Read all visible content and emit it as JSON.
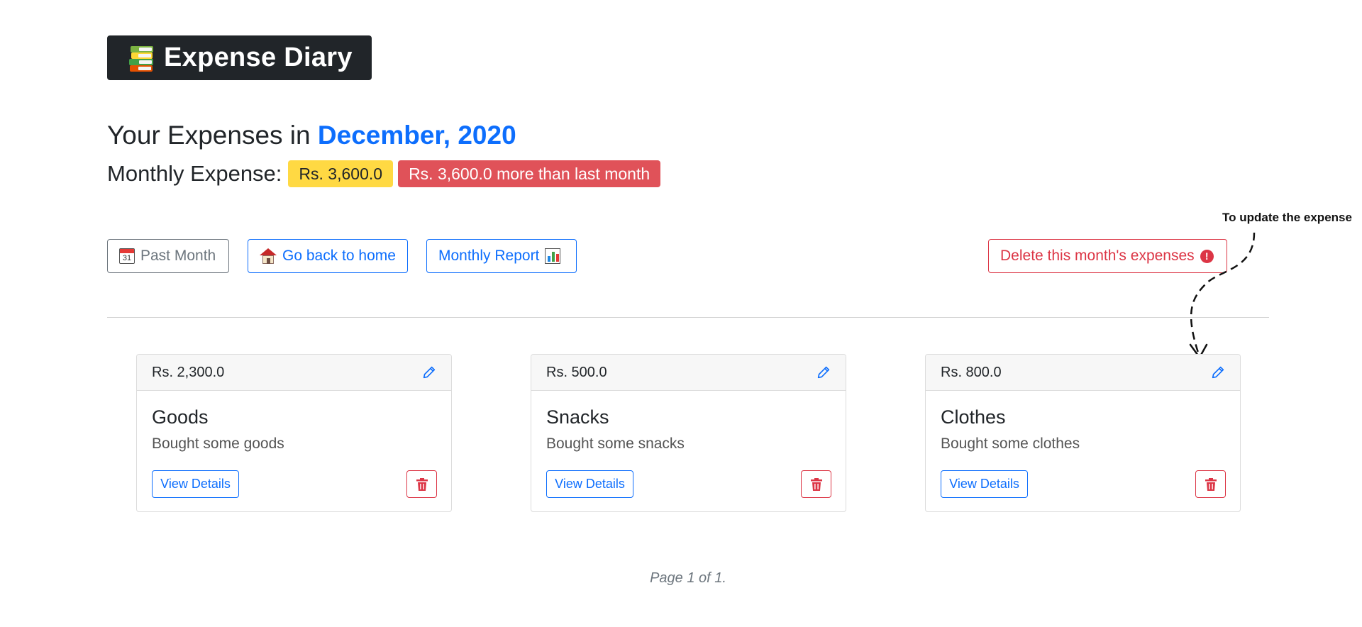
{
  "brand": {
    "title": "Expense Diary",
    "icon": "books-icon"
  },
  "heading": {
    "prefix": "Your Expenses in ",
    "month": "December, 2020"
  },
  "monthly": {
    "label": "Monthly Expense:",
    "total_badge": "Rs. 3,600.0",
    "comparison_badge": "Rs. 3,600.0 more than last month"
  },
  "actions": {
    "past_month": "Past Month",
    "go_home": "Go back to home",
    "monthly_report": "Monthly Report",
    "delete_month": "Delete this month's expenses"
  },
  "annotation": {
    "text": "To update the expense"
  },
  "cards": [
    {
      "amount": "Rs. 2,300.0",
      "title": "Goods",
      "description": "Bought some goods",
      "view_label": "View Details"
    },
    {
      "amount": "Rs. 500.0",
      "title": "Snacks",
      "description": "Bought some snacks",
      "view_label": "View Details"
    },
    {
      "amount": "Rs. 800.0",
      "title": "Clothes",
      "description": "Bought some clothes",
      "view_label": "View Details"
    }
  ],
  "pagination": {
    "text": "Page 1 of 1."
  },
  "colors": {
    "primary": "#0d6efd",
    "danger": "#dc3545",
    "warning": "#ffd943",
    "dark": "#212529",
    "secondary": "#6c757d"
  },
  "icons": {
    "past_month": "calendar-icon",
    "go_home": "house-icon",
    "monthly_report": "bar-chart-icon",
    "delete_month": "exclamation-icon",
    "edit": "pencil-icon",
    "delete": "trash-icon"
  }
}
